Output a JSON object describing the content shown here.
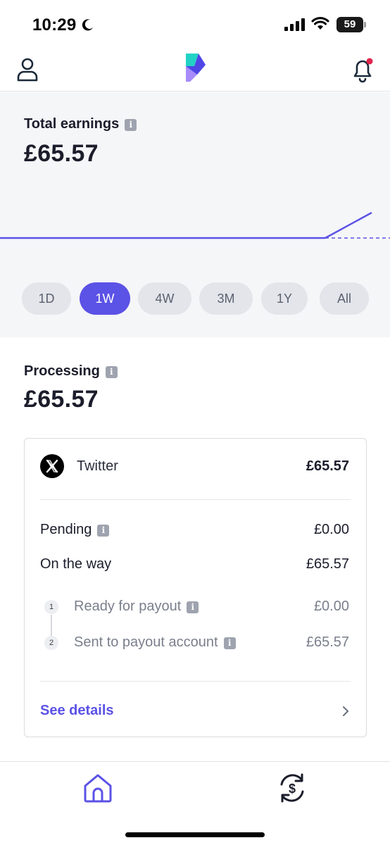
{
  "status_bar": {
    "time": "10:29",
    "battery": "59"
  },
  "header": {
    "profile_icon": "person-icon",
    "logo_icon": "app-logo-icon",
    "notification_icon": "bell-icon",
    "notification_badge_color": "#e0264b"
  },
  "earnings": {
    "title": "Total earnings",
    "amount": "£65.57",
    "accent_color": "#5b52e6",
    "ranges": [
      "1D",
      "1W",
      "4W",
      "3M",
      "1Y",
      "All"
    ],
    "selected_range": "1W"
  },
  "processing": {
    "title": "Processing",
    "amount": "£65.57",
    "source": {
      "name": "Twitter",
      "amount": "£65.57",
      "icon": "x-logo-icon"
    },
    "pending": {
      "label": "Pending",
      "value": "£0.00"
    },
    "on_the_way": {
      "label": "On the way",
      "value": "£65.57"
    },
    "steps": [
      {
        "num": "1",
        "label": "Ready for payout",
        "value": "£0.00"
      },
      {
        "num": "2",
        "label": "Sent to payout account",
        "value": "£65.57"
      }
    ],
    "see_details": "See details"
  },
  "tab_bar": {
    "home_icon": "home-icon",
    "payout_icon": "currency-exchange-icon"
  }
}
